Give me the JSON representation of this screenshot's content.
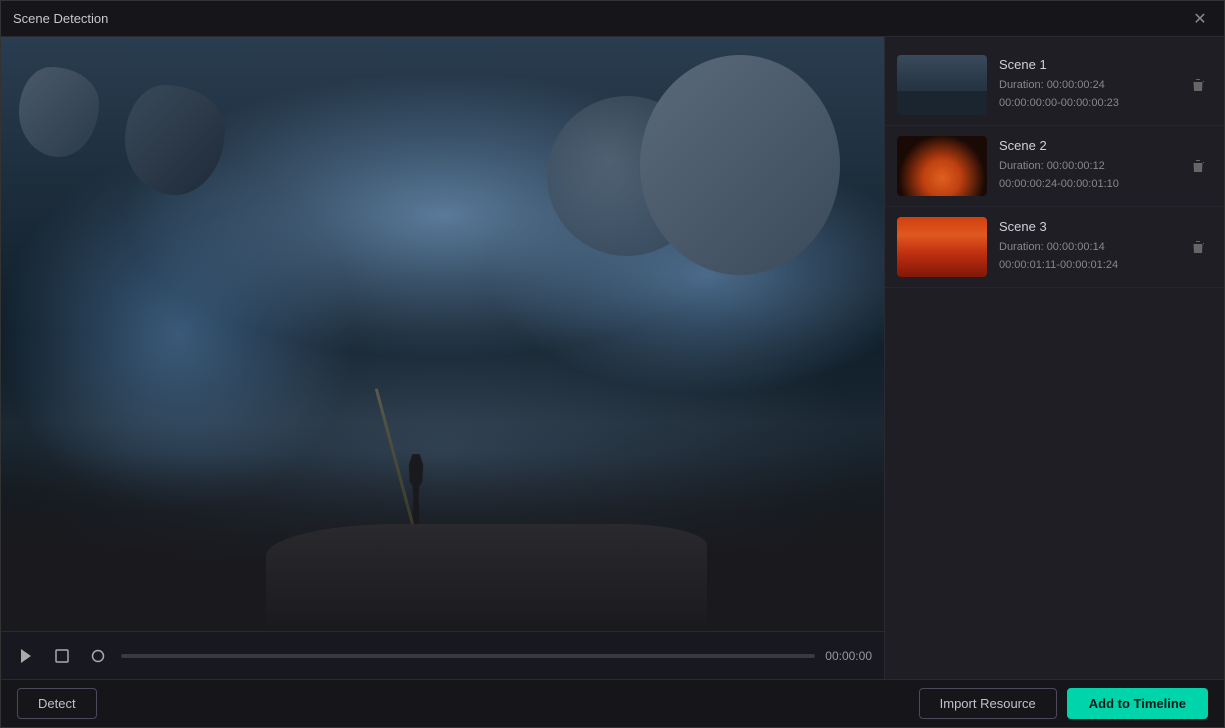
{
  "window": {
    "title": "Scene Detection"
  },
  "video": {
    "time": "00:00:00",
    "progress": 0
  },
  "scenes": [
    {
      "id": 1,
      "name": "Scene 1",
      "duration_label": "Duration: 00:00:00:24",
      "range_label": "00:00:00:00-00:00:00:23",
      "thumb_class": "thumb-1"
    },
    {
      "id": 2,
      "name": "Scene 2",
      "duration_label": "Duration: 00:00:00:12",
      "range_label": "00:00:00:24-00:00:01:10",
      "thumb_class": "thumb-2"
    },
    {
      "id": 3,
      "name": "Scene 3",
      "duration_label": "Duration: 00:00:00:14",
      "range_label": "00:00:01:11-00:00:01:24",
      "thumb_class": "thumb-3"
    }
  ],
  "buttons": {
    "detect": "Detect",
    "import_resource": "Import Resource",
    "add_to_timeline": "Add to Timeline"
  },
  "icons": {
    "close": "✕",
    "play": "play",
    "crop": "crop",
    "circle": "circle",
    "trash": "trash"
  }
}
